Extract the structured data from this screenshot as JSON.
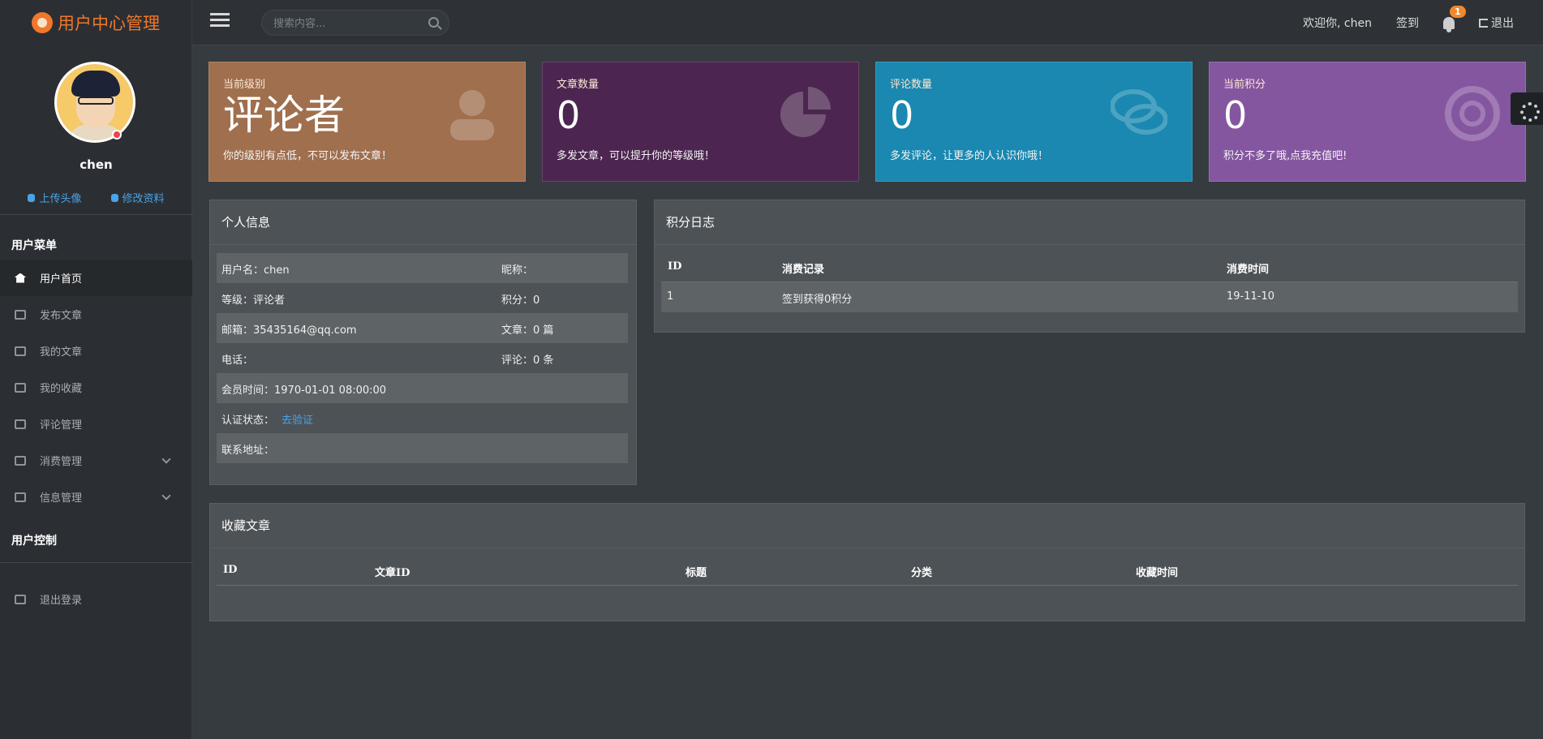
{
  "header": {
    "brand": "用户中心管理",
    "search_placeholder": "搜索内容...",
    "welcome": "欢迎你, chen",
    "checkin": "签到",
    "notifications": "1",
    "logout": "退出"
  },
  "sidebar": {
    "user_name": "chen",
    "upload_avatar": "上传头像",
    "edit_profile": "修改资料",
    "menu_title": "用户菜单",
    "items": [
      {
        "label": "用户首页",
        "icon": "home-icon"
      },
      {
        "label": "发布文章",
        "icon": "edit-icon"
      },
      {
        "label": "我的文章",
        "icon": "external-link-icon"
      },
      {
        "label": "我的收藏",
        "icon": "archive-icon"
      },
      {
        "label": "评论管理",
        "icon": "comments-icon"
      },
      {
        "label": "消费管理",
        "icon": "credit-card-icon"
      },
      {
        "label": "信息管理",
        "icon": "star-icon"
      }
    ],
    "control_title": "用户控制",
    "logout_label": "退出登录"
  },
  "cards": [
    {
      "label": "当前级别",
      "value": "评论者",
      "desc": "你的级别有点低，不可以发布文章！",
      "color": "#a06f4e",
      "icon": "user-icon"
    },
    {
      "label": "文章数量",
      "value": "0",
      "desc": "多发文章，可以提升你的等级哦！",
      "color": "#4c2650",
      "icon": "pie-chart-icon"
    },
    {
      "label": "评论数量",
      "value": "0",
      "desc": "多发评论，让更多的人认识你哦！",
      "color": "#1a88b0",
      "icon": "comments-icon"
    },
    {
      "label": "当前积分",
      "value": "0",
      "desc": "积分不多了哦,点我充值吧!",
      "color": "#8556a0",
      "icon": "life-ring-icon"
    }
  ],
  "personal": {
    "title": "个人信息",
    "rows": [
      {
        "left": "用户名：chen",
        "right": "昵称："
      },
      {
        "left": "等级：评论者",
        "right": "积分：0"
      },
      {
        "left": "邮箱：35435164@qq.com",
        "right": "文章：0 篇"
      },
      {
        "left": "电话：",
        "right": "评论：0 条"
      },
      {
        "left": "会员时间：1970-01-01 08:00:00",
        "right": ""
      },
      {
        "left": "认证状态：",
        "right": "",
        "link": "去验证"
      },
      {
        "left": "联系地址：",
        "right": ""
      }
    ]
  },
  "points_log": {
    "title": "积分日志",
    "headers": [
      "ID",
      "消费记录",
      "消费时间"
    ],
    "rows": [
      {
        "id": "1",
        "record": "签到获得0积分",
        "time": "19-11-10"
      }
    ]
  },
  "favorites": {
    "title": "收藏文章",
    "headers": [
      "ID",
      "文章ID",
      "标题",
      "分类",
      "收藏时间"
    ]
  }
}
